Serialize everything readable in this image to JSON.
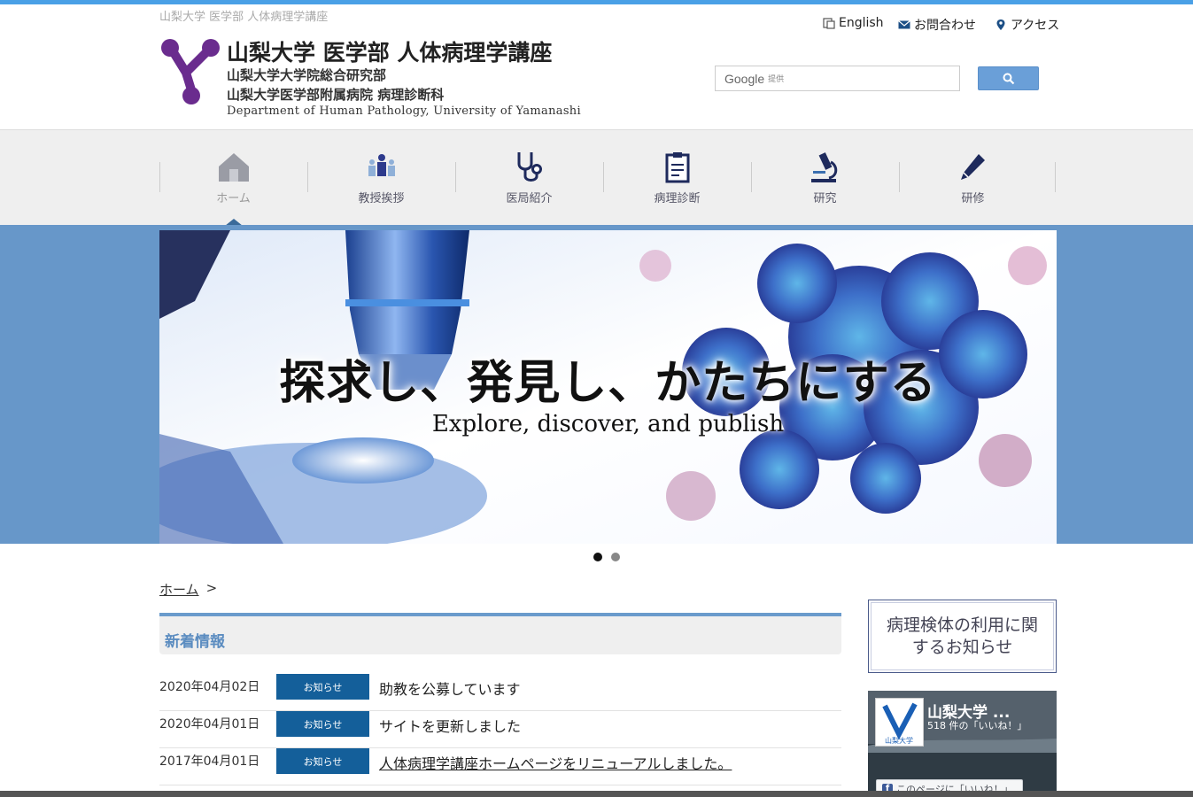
{
  "header": {
    "tagline": "山梨大学 医学部 人体病理学講座",
    "title_jp": "山梨大学 医学部 人体病理学講座",
    "subtitle1": "山梨大学大学院総合研究部",
    "subtitle2": "山梨大学医学部附属病院 病理診断科",
    "title_en": "Department of Human Pathology, University of Yamanashi",
    "logo_color": "#6a2c8e"
  },
  "utility_links": [
    {
      "label": "English",
      "icon": "language-icon"
    },
    {
      "label": "お問合わせ",
      "icon": "mail-icon"
    },
    {
      "label": "アクセス",
      "icon": "map-pin-icon"
    }
  ],
  "search": {
    "brand": "Google",
    "provided_by": "提供"
  },
  "nav": [
    {
      "label": "ホーム",
      "icon": "home-icon",
      "active": true
    },
    {
      "label": "教授挨拶",
      "icon": "people-icon"
    },
    {
      "label": "医局紹介",
      "icon": "stethoscope-icon"
    },
    {
      "label": "病理診断",
      "icon": "clipboard-icon"
    },
    {
      "label": "研究",
      "icon": "microscope-icon"
    },
    {
      "label": "研修",
      "icon": "pencil-icon"
    }
  ],
  "hero": {
    "title": "探求し、発見し、かたちにする",
    "subtitle": "Explore, discover, and publish",
    "slide_count": 2,
    "active_slide": 1
  },
  "breadcrumb": {
    "home": "ホーム",
    "separator": ">"
  },
  "news": {
    "heading": "新着情報",
    "items": [
      {
        "date": "2020年04月02日",
        "category": "お知らせ",
        "text": "助教を公募しています"
      },
      {
        "date": "2020年04月01日",
        "category": "お知らせ",
        "text": "サイトを更新しました"
      },
      {
        "date": "2017年04月01日",
        "category": "お知らせ",
        "text": "人体病理学講座ホームページをリニューアルしました。"
      }
    ]
  },
  "sidebar": {
    "notice": "病理検体の利用に関するお知らせ",
    "facebook": {
      "name": "山梨大学 ...",
      "likes": "518 件の「いいね！」",
      "logo_text": "山梨大学",
      "like_button": "このページに「いいね！」"
    }
  },
  "colors": {
    "accent": "#4aa0e6",
    "hero_band": "#6797c9",
    "badge": "#145f9a",
    "news_heading": "#5b8cc0"
  }
}
